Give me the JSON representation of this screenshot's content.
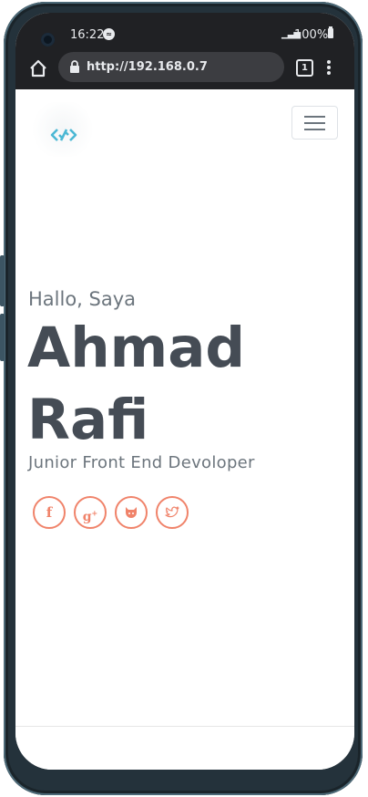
{
  "status_bar": {
    "time": "16:22",
    "battery": "100%"
  },
  "browser": {
    "url": "http://192.168.0.7",
    "tab_count": "1"
  },
  "page": {
    "greeting": "Hallo, Saya",
    "name_line1": "Ahmad",
    "name_line2": "Rafi",
    "role": "Junior Front End Devoloper",
    "accent_color": "#f0836a",
    "heading_color": "#454c55",
    "social_icons": [
      "facebook-icon",
      "google-plus-icon",
      "github-icon",
      "twitter-icon"
    ]
  }
}
